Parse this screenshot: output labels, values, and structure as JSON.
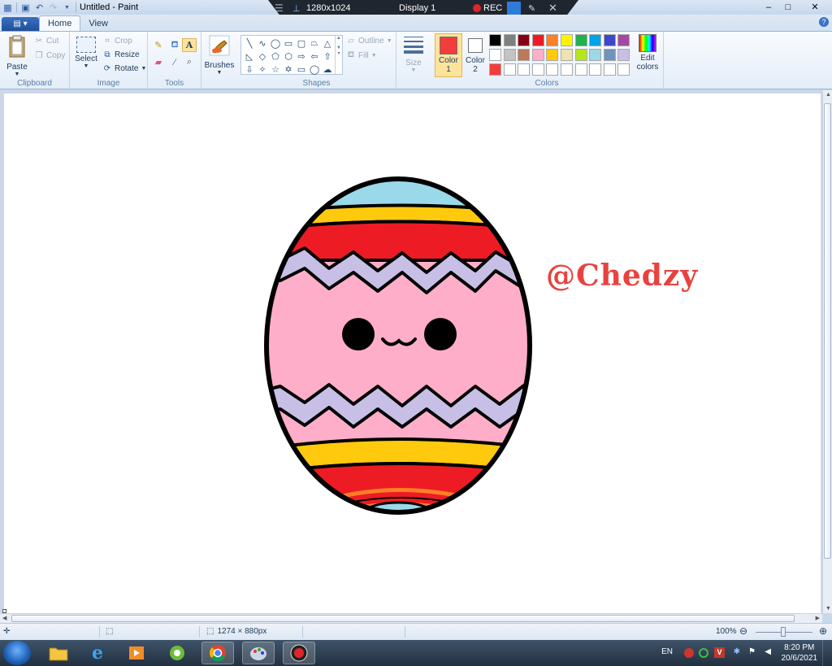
{
  "window": {
    "title": "Untitled - Paint",
    "minimize": "–",
    "maximize": "□",
    "close": "✕"
  },
  "recorder": {
    "resolution": "1280x1024",
    "display": "Display 1",
    "rec_label": "REC"
  },
  "tabs": [
    {
      "label": "Home",
      "active": true
    },
    {
      "label": "View",
      "active": false
    }
  ],
  "ribbon": {
    "clipboard": {
      "group": "Clipboard",
      "paste": "Paste",
      "cut": "Cut",
      "copy": "Copy"
    },
    "image": {
      "group": "Image",
      "select": "Select",
      "crop": "Crop",
      "resize": "Resize",
      "rotate": "Rotate"
    },
    "tools": {
      "group": "Tools"
    },
    "brushes": {
      "label": "Brushes"
    },
    "shapes": {
      "group": "Shapes",
      "outline": "Outline",
      "fill": "Fill"
    },
    "size": {
      "label": "Size"
    },
    "colors": {
      "group": "Colors",
      "color1_label": "Color",
      "color1_num": "1",
      "color2_label": "Color",
      "color2_num": "2",
      "color1_value": "#f23d3d",
      "color2_value": "#ffffff",
      "edit": "Edit",
      "edit2": "colors",
      "palette": [
        "#000000",
        "#7f7f7f",
        "#880015",
        "#ed1c24",
        "#ff7f27",
        "#fff200",
        "#22b14c",
        "#00a2e8",
        "#3f48cc",
        "#a349a4",
        "#ffffff",
        "#c3c3c3",
        "#b97a57",
        "#ffaec9",
        "#ffc90e",
        "#efe4b0",
        "#b5e61d",
        "#99d9ea",
        "#7092be",
        "#c8bfe7",
        "#f23d3d",
        "#ffffff",
        "#ffffff",
        "#ffffff",
        "#ffffff",
        "#ffffff",
        "#ffffff",
        "#ffffff",
        "#ffffff",
        "#ffffff"
      ]
    }
  },
  "canvas": {
    "watermark": "@Chedzy",
    "colors": {
      "outline": "#000000",
      "blue": "#99d9ea",
      "yellow": "#ffc90e",
      "red": "#ed1c24",
      "lavender": "#c8bfe7",
      "pink": "#ffaec9",
      "orange": "#ff7f27"
    }
  },
  "status": {
    "image_size": "1274 × 880px",
    "zoom": "100%"
  },
  "taskbar": {
    "language": "EN",
    "time": "8:20 PM",
    "date": "20/6/2021"
  }
}
